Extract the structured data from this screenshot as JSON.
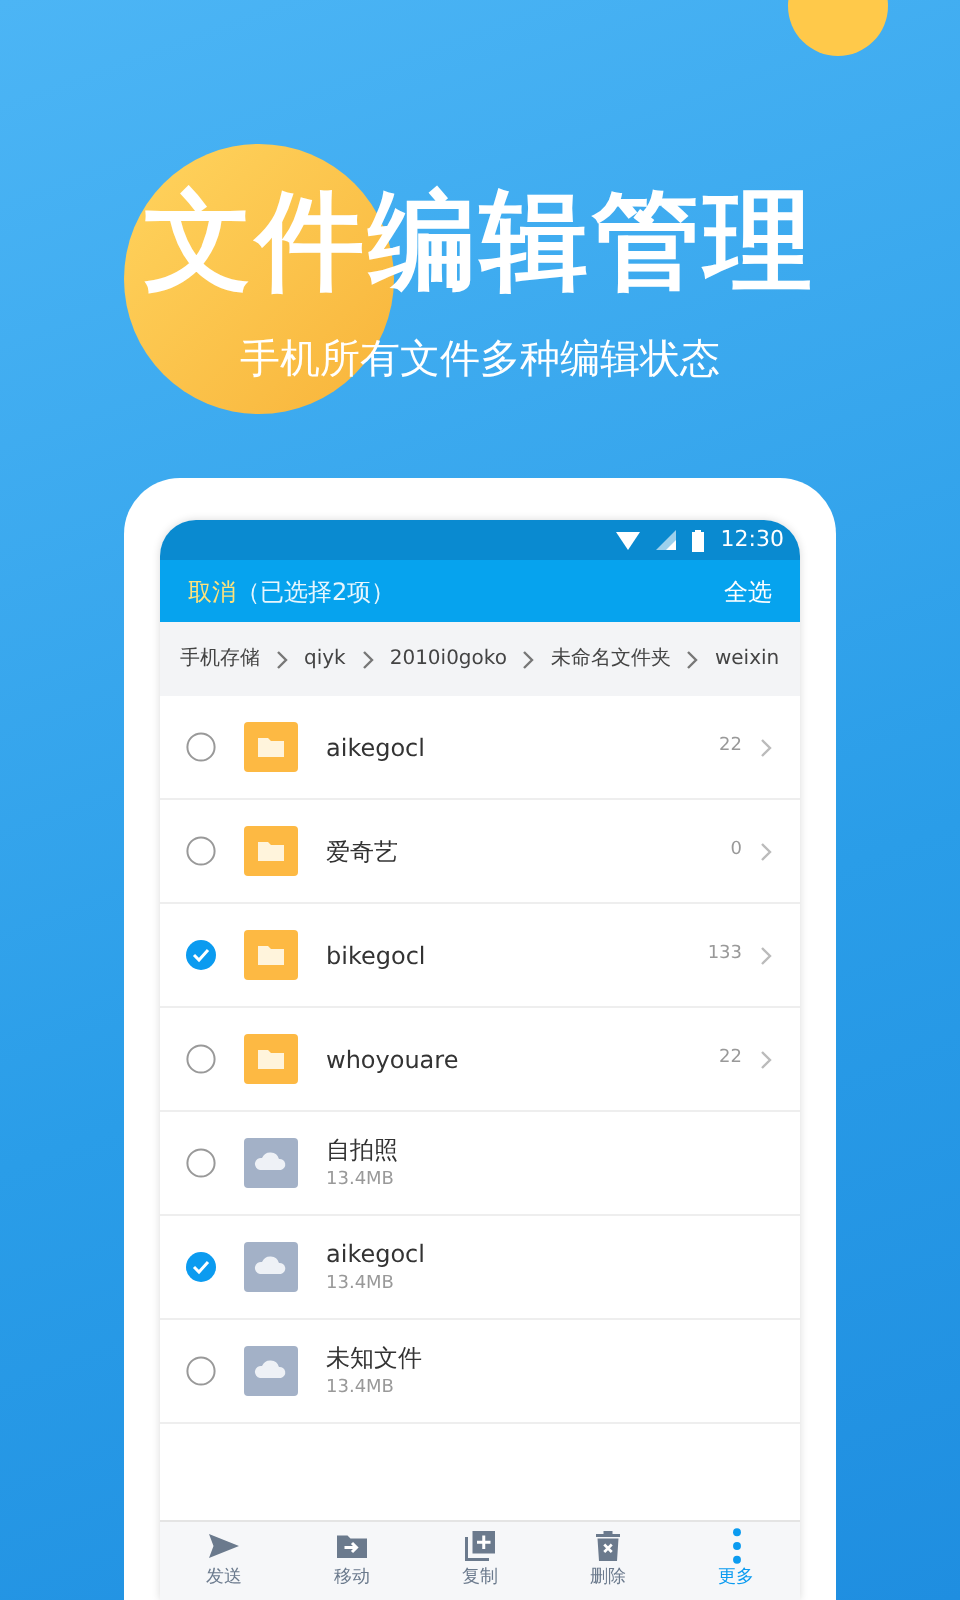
{
  "headline": "文件编辑管理",
  "subheadline": "手机所有文件多种编辑状态",
  "status_bar": {
    "time": "12:30"
  },
  "header": {
    "cancel": "取消",
    "selection": "（已选择2项）",
    "select_all": "全选"
  },
  "breadcrumbs": [
    "手机存储",
    "qiyk",
    "2010i0goko",
    "未命名文件夹",
    "weixin"
  ],
  "files": [
    {
      "kind": "folder",
      "name": "aikegocl",
      "count": "22",
      "selected": false
    },
    {
      "kind": "folder",
      "name": "爱奇艺",
      "count": "0",
      "selected": false
    },
    {
      "kind": "folder",
      "name": "bikegocl",
      "count": "133",
      "selected": true
    },
    {
      "kind": "folder",
      "name": "whoyouare",
      "count": "22",
      "selected": false
    },
    {
      "kind": "file",
      "name": "自拍照",
      "size": "13.4MB",
      "selected": false
    },
    {
      "kind": "file",
      "name": "aikegocl",
      "size": "13.4MB",
      "selected": true
    },
    {
      "kind": "file",
      "name": "未知文件",
      "size": "13.4MB",
      "selected": false
    }
  ],
  "actions": [
    {
      "kind": "send",
      "label": "发送",
      "selected": false
    },
    {
      "kind": "move",
      "label": "移动",
      "selected": false
    },
    {
      "kind": "copy",
      "label": "复制",
      "selected": false
    },
    {
      "kind": "delete",
      "label": "删除",
      "selected": false
    },
    {
      "kind": "more",
      "label": "更多",
      "selected": true
    }
  ]
}
